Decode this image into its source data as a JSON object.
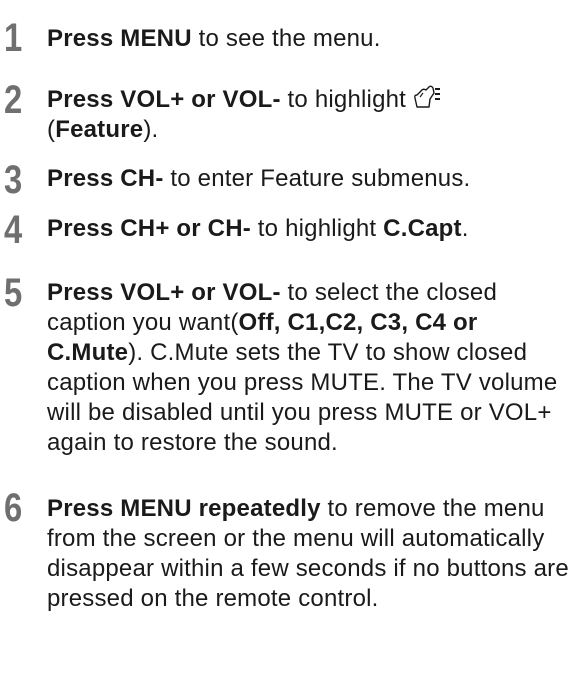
{
  "steps": [
    {
      "number": "1",
      "bold": "Press MENU",
      "text": " to see the menu."
    },
    {
      "number": "2",
      "bold": "Press VOL+ or VOL-",
      "text": " to highlight ",
      "icon": "feature-icon",
      "line2_open": "(",
      "line2_bold": "Feature",
      "line2_close": ")."
    },
    {
      "number": "3",
      "bold": "Press CH-",
      "text": " to enter Feature submenus."
    },
    {
      "number": "4",
      "bold": "Press CH+ or CH-",
      "text": " to highlight ",
      "bold2": "C.Capt",
      "text2": "."
    },
    {
      "number": "5",
      "bold": "Press VOL+ or VOL-",
      "text": " to select the closed caption you want(",
      "bold2": "Off, C1,C2, C3, C4 or C.Mute",
      "text2": "). C.Mute sets the TV to show closed caption when you press MUTE. The TV volume will be disabled until you press MUTE or VOL+ again to restore the sound."
    },
    {
      "number": "6",
      "bold": "Press MENU repeatedly",
      "text": " to remove the menu from the screen or the menu will automatically disappear within a few seconds if no buttons are pressed on the remote control."
    }
  ]
}
